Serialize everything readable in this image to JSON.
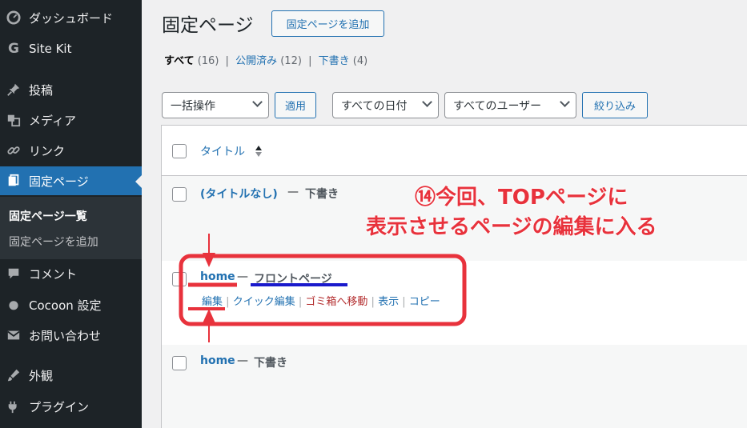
{
  "sidebar": {
    "items": [
      {
        "label": "ダッシュボード",
        "icon": "dashboard-icon"
      },
      {
        "label": "Site Kit",
        "icon": "google-g-icon"
      },
      {
        "label": "投稿",
        "icon": "pushpin-icon"
      },
      {
        "label": "メディア",
        "icon": "media-icon"
      },
      {
        "label": "リンク",
        "icon": "link-icon"
      },
      {
        "label": "固定ページ",
        "icon": "pages-icon"
      },
      {
        "label": "コメント",
        "icon": "comment-icon"
      },
      {
        "label": "Cocoon 設定",
        "icon": "egg-icon"
      },
      {
        "label": "お問い合わせ",
        "icon": "mail-icon"
      },
      {
        "label": "外観",
        "icon": "brush-icon"
      },
      {
        "label": "プラグイン",
        "icon": "plugin-icon"
      }
    ],
    "submenu": [
      "固定ページ一覧",
      "固定ページを追加"
    ]
  },
  "header": {
    "title": "固定ページ",
    "add_new": "固定ページを追加"
  },
  "filters": {
    "all_label": "すべて",
    "all_count": "(16)",
    "publish_label": "公開済み",
    "publish_count": "(12)",
    "draft_label": "下書き",
    "draft_count": "(4)",
    "sep": "|"
  },
  "toolbar": {
    "bulk_action": "一括操作",
    "apply": "適用",
    "dates": "すべての日付",
    "users": "すべてのユーザー",
    "filter": "絞り込み"
  },
  "table": {
    "col_title": "タイトル",
    "sort_icon": "sort-arrows-icon",
    "rows": [
      {
        "title": "(タイトルなし)",
        "dash": "—",
        "state": "下書き"
      },
      {
        "title": "home",
        "dash": "—",
        "state": "フロントページ"
      },
      {
        "title": "home",
        "dash": "—",
        "state": "下書き"
      }
    ],
    "row_actions": {
      "edit": "編集",
      "quick_edit": "クイック編集",
      "trash": "ゴミ箱へ移動",
      "view": "表示",
      "copy": "コピー",
      "sep": "|"
    }
  },
  "annotation": {
    "line1": "⑭今回、TOPページに",
    "line2": "表示させるページの編集に入る",
    "color": "#e8323c",
    "underline_color": "#1a1acc"
  }
}
